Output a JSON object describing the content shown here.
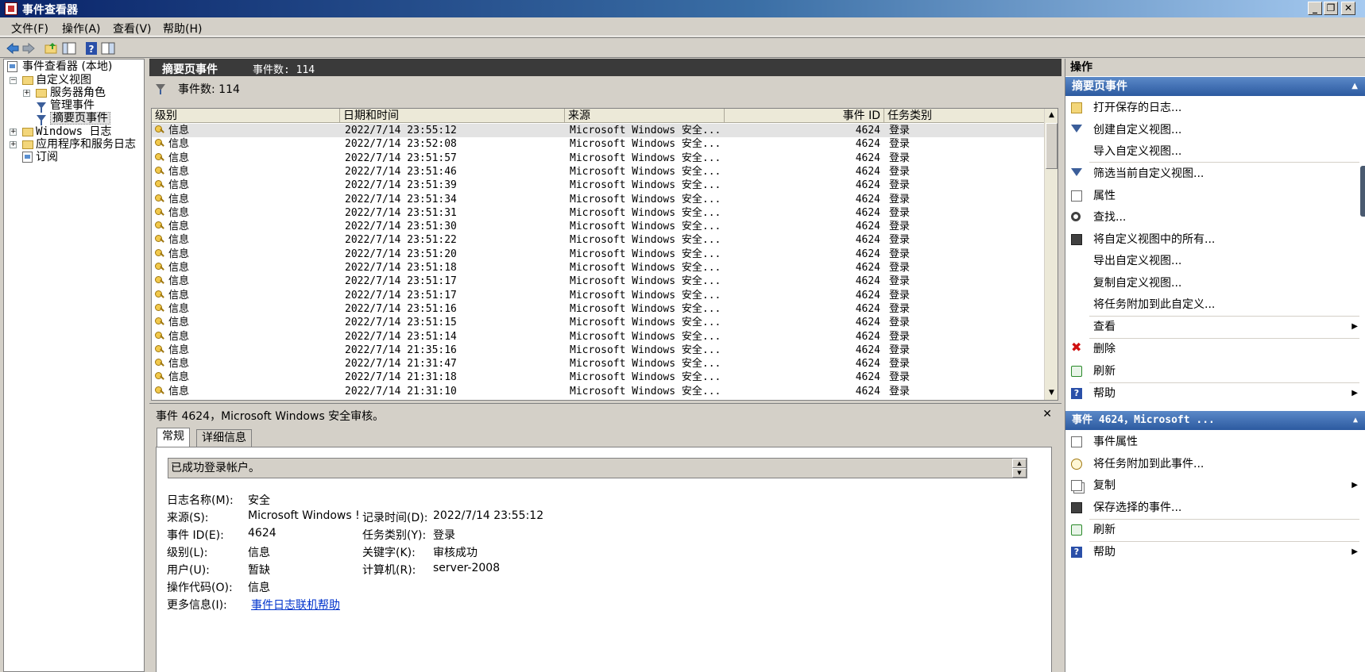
{
  "window": {
    "title": "事件查看器",
    "btn_min": "_",
    "btn_restore": "❐",
    "btn_close": "✕"
  },
  "menu": [
    "文件(F)",
    "操作(A)",
    "查看(V)",
    "帮助(H)"
  ],
  "tree": {
    "root": "事件查看器 (本地)",
    "custom_views": "自定义视图",
    "server_roles": "服务器角色",
    "admin_events": "管理事件",
    "summary_events": "摘要页事件",
    "windows_logs": "Windows 日志",
    "app_service_logs": "应用程序和服务日志",
    "subscriptions": "订阅",
    "expand_minus": "−",
    "expand_plus": "+"
  },
  "center": {
    "header_title": "摘要页事件",
    "header_count": "事件数: 114",
    "filter_count": "事件数: 114",
    "columns": [
      "级别",
      "日期和时间",
      "来源",
      "事件 ID",
      "任务类别"
    ],
    "rows": [
      {
        "level": "信息",
        "datetime": "2022/7/14 23:55:12",
        "source": "Microsoft Windows 安全...",
        "event_id": "4624",
        "category": "登录"
      },
      {
        "level": "信息",
        "datetime": "2022/7/14 23:52:08",
        "source": "Microsoft Windows 安全...",
        "event_id": "4624",
        "category": "登录"
      },
      {
        "level": "信息",
        "datetime": "2022/7/14 23:51:57",
        "source": "Microsoft Windows 安全...",
        "event_id": "4624",
        "category": "登录"
      },
      {
        "level": "信息",
        "datetime": "2022/7/14 23:51:46",
        "source": "Microsoft Windows 安全...",
        "event_id": "4624",
        "category": "登录"
      },
      {
        "level": "信息",
        "datetime": "2022/7/14 23:51:39",
        "source": "Microsoft Windows 安全...",
        "event_id": "4624",
        "category": "登录"
      },
      {
        "level": "信息",
        "datetime": "2022/7/14 23:51:34",
        "source": "Microsoft Windows 安全...",
        "event_id": "4624",
        "category": "登录"
      },
      {
        "level": "信息",
        "datetime": "2022/7/14 23:51:31",
        "source": "Microsoft Windows 安全...",
        "event_id": "4624",
        "category": "登录"
      },
      {
        "level": "信息",
        "datetime": "2022/7/14 23:51:30",
        "source": "Microsoft Windows 安全...",
        "event_id": "4624",
        "category": "登录"
      },
      {
        "level": "信息",
        "datetime": "2022/7/14 23:51:22",
        "source": "Microsoft Windows 安全...",
        "event_id": "4624",
        "category": "登录"
      },
      {
        "level": "信息",
        "datetime": "2022/7/14 23:51:20",
        "source": "Microsoft Windows 安全...",
        "event_id": "4624",
        "category": "登录"
      },
      {
        "level": "信息",
        "datetime": "2022/7/14 23:51:18",
        "source": "Microsoft Windows 安全...",
        "event_id": "4624",
        "category": "登录"
      },
      {
        "level": "信息",
        "datetime": "2022/7/14 23:51:17",
        "source": "Microsoft Windows 安全...",
        "event_id": "4624",
        "category": "登录"
      },
      {
        "level": "信息",
        "datetime": "2022/7/14 23:51:17",
        "source": "Microsoft Windows 安全...",
        "event_id": "4624",
        "category": "登录"
      },
      {
        "level": "信息",
        "datetime": "2022/7/14 23:51:16",
        "source": "Microsoft Windows 安全...",
        "event_id": "4624",
        "category": "登录"
      },
      {
        "level": "信息",
        "datetime": "2022/7/14 23:51:15",
        "source": "Microsoft Windows 安全...",
        "event_id": "4624",
        "category": "登录"
      },
      {
        "level": "信息",
        "datetime": "2022/7/14 23:51:14",
        "source": "Microsoft Windows 安全...",
        "event_id": "4624",
        "category": "登录"
      },
      {
        "level": "信息",
        "datetime": "2022/7/14 21:35:16",
        "source": "Microsoft Windows 安全...",
        "event_id": "4624",
        "category": "登录"
      },
      {
        "level": "信息",
        "datetime": "2022/7/14 21:31:47",
        "source": "Microsoft Windows 安全...",
        "event_id": "4624",
        "category": "登录"
      },
      {
        "level": "信息",
        "datetime": "2022/7/14 21:31:18",
        "source": "Microsoft Windows 安全...",
        "event_id": "4624",
        "category": "登录"
      },
      {
        "level": "信息",
        "datetime": "2022/7/14 21:31:10",
        "source": "Microsoft Windows 安全...",
        "event_id": "4624",
        "category": "登录"
      }
    ]
  },
  "detail": {
    "title": "事件 4624，Microsoft Windows 安全审核。",
    "close": "✕",
    "tab_general": "常规",
    "tab_details": "详细信息",
    "description": "已成功登录帐户。",
    "props": {
      "log_name_label": "日志名称(M):",
      "log_name": "安全",
      "source_label": "来源(S):",
      "source": "Microsoft Windows !",
      "logged_label": "记录时间(D):",
      "logged": "2022/7/14 23:55:12",
      "event_id_label": "事件 ID(E):",
      "event_id": "4624",
      "task_label": "任务类别(Y):",
      "task": "登录",
      "level_label": "级别(L):",
      "level": "信息",
      "keywords_label": "关键字(K):",
      "keywords": "审核成功",
      "user_label": "用户(U):",
      "user": "暂缺",
      "computer_label": "计算机(R):",
      "computer": "server-2008",
      "opcode_label": "操作代码(O):",
      "opcode": "信息",
      "more_info_label": "更多信息(I):",
      "more_info_link": "事件日志联机帮助"
    }
  },
  "actions": {
    "title": "操作",
    "section1": "摘要页事件",
    "section1_items": [
      "打开保存的日志...",
      "创建自定义视图...",
      "导入自定义视图...",
      "筛选当前自定义视图...",
      "属性",
      "查找...",
      "将自定义视图中的所有...",
      "导出自定义视图...",
      "复制自定义视图...",
      "将任务附加到此自定义...",
      "查看",
      "删除",
      "刷新",
      "帮助"
    ],
    "section2": "事件 4624，Microsoft ...",
    "section2_items": [
      "事件属性",
      "将任务附加到此事件...",
      "复制",
      "保存选择的事件...",
      "刷新",
      "帮助"
    ]
  }
}
